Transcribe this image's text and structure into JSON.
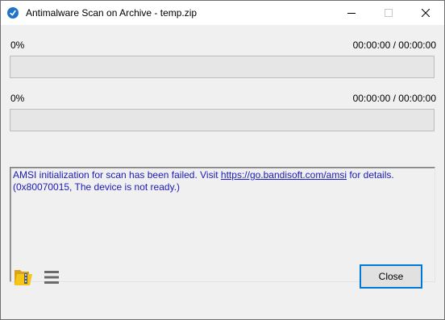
{
  "window": {
    "title": "Antimalware Scan on Archive - temp.zip"
  },
  "progress": [
    {
      "percent_label": "0%",
      "time_label": "00:00:00 / 00:00:00",
      "value": 0
    },
    {
      "percent_label": "0%",
      "time_label": "00:00:00 / 00:00:00",
      "value": 0
    }
  ],
  "log": {
    "text_before": "AMSI initialization for scan has been failed. Visit ",
    "link": "https://go.bandisoft.com/amsi",
    "text_after": " for details. (0x80070015, The device is not ready.)"
  },
  "footer": {
    "folder_icon": "open-folder-icon",
    "menu_icon": "hamburger-menu-icon",
    "close_label": "Close"
  },
  "colors": {
    "log_text": "#1a1ab8",
    "button_focus_border": "#0078d7"
  }
}
